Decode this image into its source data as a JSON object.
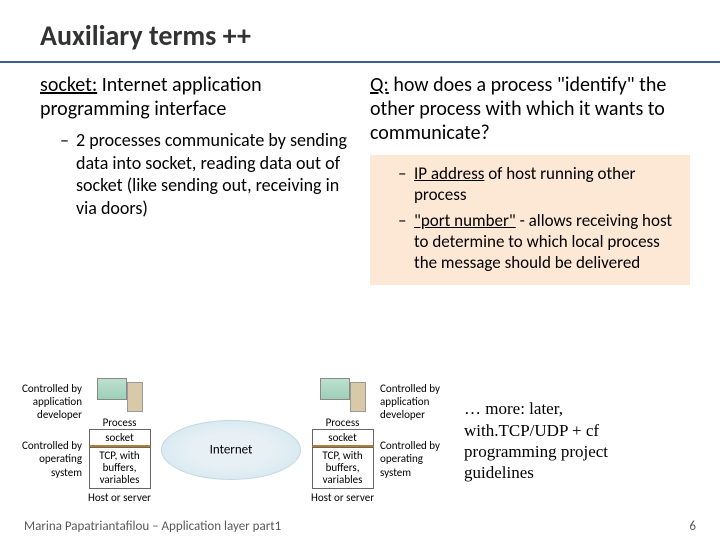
{
  "title": "Auxiliary terms ++",
  "left": {
    "heading_pre": "socket:",
    "heading_rest": " Internet application programming interface",
    "bullet1": "2 processes communicate by sending data into socket, reading data out of socket (like sending out, receiving in via doors)"
  },
  "right": {
    "q_label": "Q:",
    "q_text": " how does a process \"identify\" the other process with which it wants to communicate?",
    "bullet1_pre": "IP address",
    "bullet1_rest": " of host running other process",
    "bullet2_pre": "\"port number\"",
    "bullet2_rest": " - allows receiving host to determine to which local process the message should be delivered"
  },
  "diagram": {
    "ctrl_dev": "Controlled by application developer",
    "ctrl_os": "Controlled by operating system",
    "process": "Process",
    "socket": "socket",
    "tcp": "TCP, with buffers, variables",
    "host": "Host or server",
    "internet": "Internet"
  },
  "more": "… more: later, with.TCP/UDP + cf programming project guidelines",
  "footer": {
    "author": "Marina Papatriantafilou – Application layer part1",
    "page": "6"
  }
}
